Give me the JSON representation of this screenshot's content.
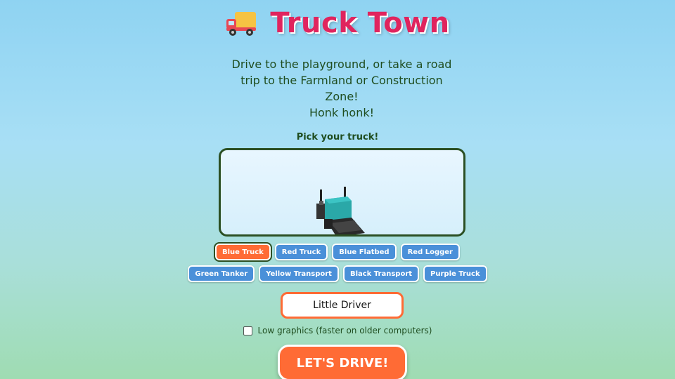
{
  "header": {
    "title": "Truck Town",
    "icon": "delivery-truck-icon"
  },
  "intro": {
    "line1": "Drive to the playground, or take a road",
    "line2": "trip to the Farmland or Construction",
    "line3": "Zone!",
    "line4": "Honk honk!"
  },
  "picker": {
    "label": "Pick your truck!",
    "row1": [
      "Blue Truck",
      "Red Truck",
      "Blue Flatbed",
      "Red Logger"
    ],
    "row2": [
      "Green Tanker",
      "Yellow Transport",
      "Black Transport",
      "Purple Truck"
    ],
    "selected": "Blue Truck"
  },
  "driver": {
    "name_value": "Little Driver"
  },
  "settings": {
    "low_graphics_label": "Low graphics (faster on older computers)",
    "low_graphics_checked": false
  },
  "actions": {
    "drive_label": "LET'S DRIVE!"
  },
  "colors": {
    "title": "#e0245e",
    "accent": "#ff6b35",
    "button": "#4a90d9",
    "preview_border": "#2b4f23"
  }
}
